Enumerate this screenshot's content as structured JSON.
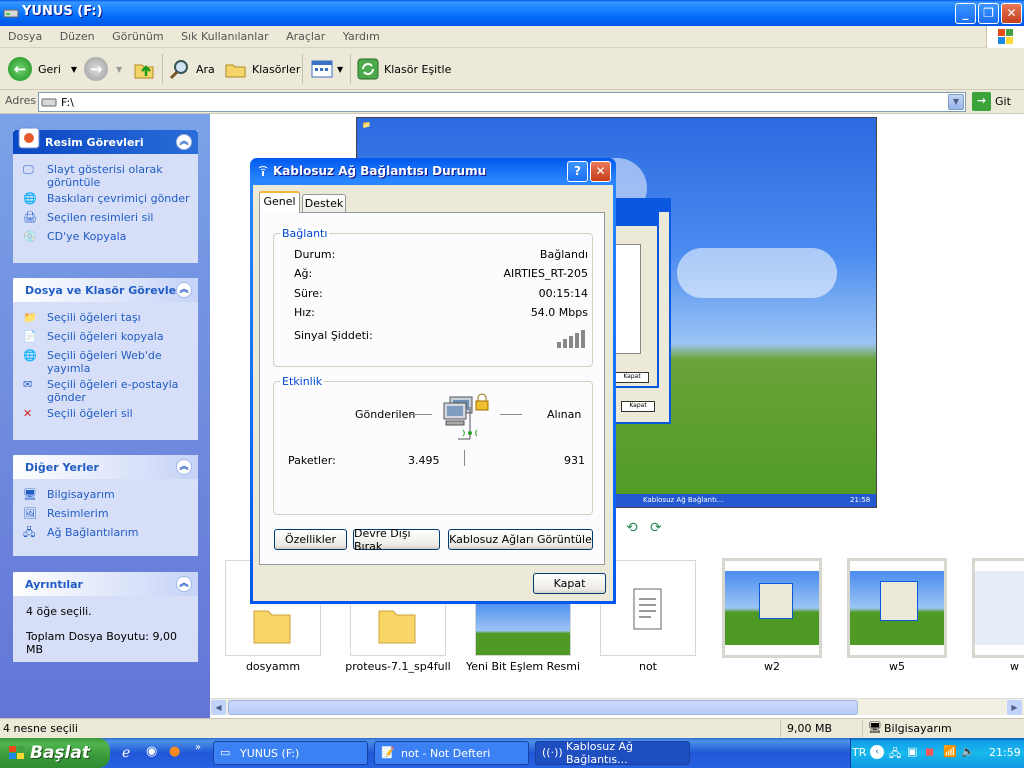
{
  "window": {
    "title": "YUNUS (F:)"
  },
  "menu": [
    "Dosya",
    "Düzen",
    "Görünüm",
    "Sık Kullanılanlar",
    "Araçlar",
    "Yardım"
  ],
  "toolbar": {
    "back": "Geri",
    "search": "Ara",
    "folders": "Klasörler",
    "sync": "Klasör Eşitle"
  },
  "address": {
    "label": "Adres",
    "value": "F:\\",
    "go": "Git"
  },
  "sidebar": {
    "picture_tasks": {
      "title": "Resim Görevleri",
      "items": [
        "Slayt gösterisi olarak görüntüle",
        "Baskıları çevrimiçi gönder",
        "Seçilen resimleri sil",
        "CD'ye Kopyala"
      ]
    },
    "file_tasks": {
      "title": "Dosya ve Klasör Görevleri",
      "items": [
        "Seçili öğeleri taşı",
        "Seçili öğeleri kopyala",
        "Seçili öğeleri Web'de yayımla",
        "Seçili öğeleri e-postayla gönder",
        "Seçili öğeleri sil"
      ]
    },
    "other_places": {
      "title": "Diğer Yerler",
      "items": [
        "Bilgisayarım",
        "Resimlerim",
        "Ağ Bağlantılarım"
      ]
    },
    "details": {
      "title": "Ayrıntılar",
      "selected": "4 öğe seçili.",
      "total": "Toplam Dosya Boyutu: 9,00 MB"
    }
  },
  "files": [
    "dosyamm",
    "proteus-7.1_sp4full",
    "Yeni Bit Eşlem Resmi",
    "not",
    "w2",
    "w5",
    "w"
  ],
  "status": {
    "left": "4 nesne seçili",
    "size": "9,00 MB",
    "location": "Bilgisayarım"
  },
  "taskbar": {
    "start": "Başlat",
    "tasks": [
      "YUNUS (F:)",
      "not - Not Defteri",
      "Kablosuz Ağ Bağlantıs..."
    ],
    "lang": "TR",
    "time": "21:59"
  },
  "dialog": {
    "title": "Kablosuz Ağ Bağlantısı Durumu",
    "help": "?",
    "tabs": [
      "Genel",
      "Destek"
    ],
    "connection": {
      "group": "Bağlantı",
      "status_label": "Durum:",
      "status": "Bağlandı",
      "network_label": "Ağ:",
      "network": "AIRTIES_RT-205",
      "duration_label": "Süre:",
      "duration": "00:15:14",
      "speed_label": "Hız:",
      "speed": "54.0 Mbps",
      "signal_label": "Sinyal Şiddeti:"
    },
    "activity": {
      "group": "Etkinlik",
      "sent": "Gönderilen",
      "received": "Alınan",
      "packets_label": "Paketler:",
      "packets_sent": "3.495",
      "packets_received": "931"
    },
    "buttons": {
      "properties": "Özellikler",
      "disable": "Devre Dışı Bırak",
      "view_networks": "Kablosuz Ağları Görüntüle",
      "close": "Kapat"
    }
  },
  "preview": {
    "close1": "Kapat",
    "close2": "Kapat",
    "taskbar_text": "Kablosuz Ağ Bağlantı...",
    "time": "21:58"
  }
}
